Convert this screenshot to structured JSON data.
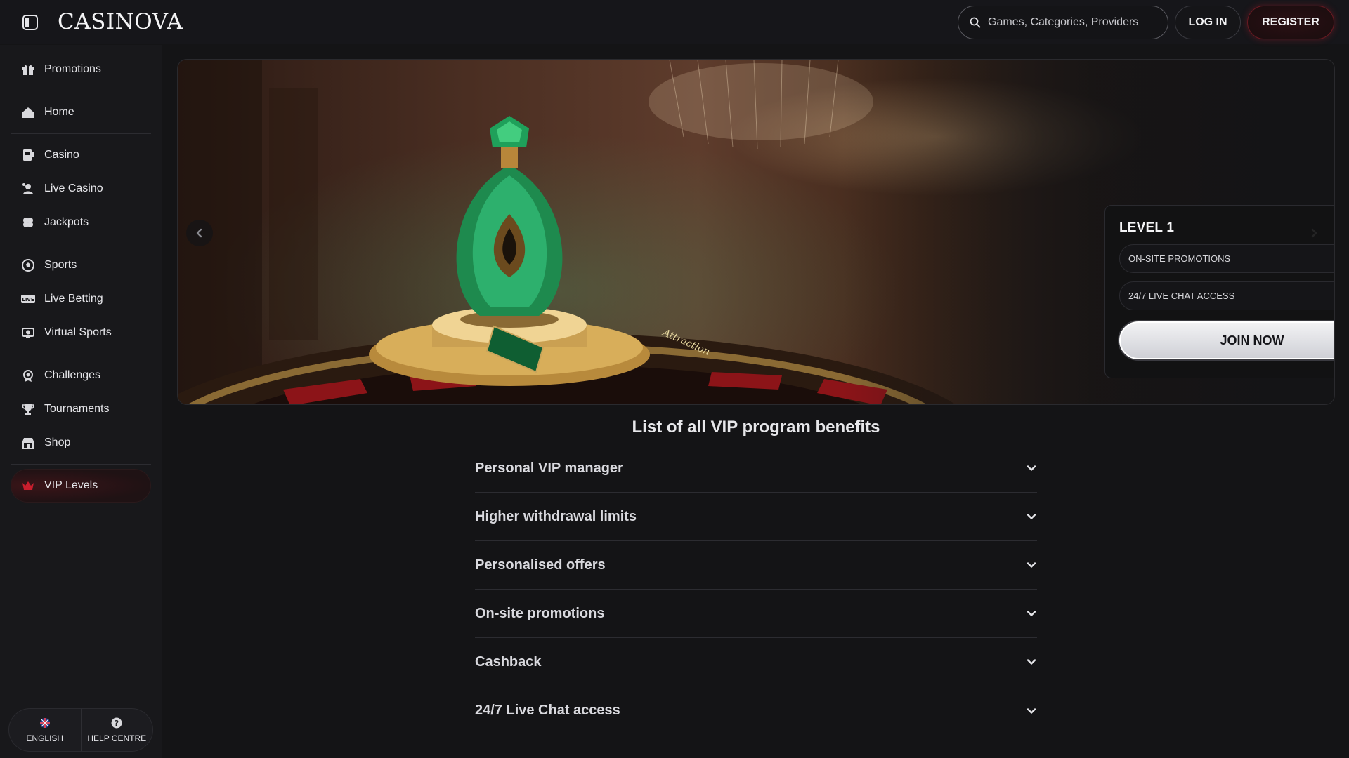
{
  "header": {
    "logo": "CASINOVA",
    "search_placeholder": "Games, Categories, Providers",
    "login_label": "LOG IN",
    "register_label": "REGISTER"
  },
  "sidebar": {
    "groups": [
      [
        {
          "label": "Promotions",
          "icon": "gift-icon"
        }
      ],
      [
        {
          "label": "Home",
          "icon": "home-icon"
        }
      ],
      [
        {
          "label": "Casino",
          "icon": "slot-machine-icon"
        },
        {
          "label": "Live Casino",
          "icon": "live-dealer-icon"
        },
        {
          "label": "Jackpots",
          "icon": "clover-icon"
        }
      ],
      [
        {
          "label": "Sports",
          "icon": "football-icon"
        },
        {
          "label": "Live Betting",
          "icon": "live-badge-icon"
        },
        {
          "label": "Virtual Sports",
          "icon": "virtual-sports-icon"
        }
      ],
      [
        {
          "label": "Challenges",
          "icon": "target-icon"
        },
        {
          "label": "Tournaments",
          "icon": "trophy-icon"
        },
        {
          "label": "Shop",
          "icon": "shop-icon"
        }
      ],
      [
        {
          "label": "VIP Levels",
          "icon": "crown-icon",
          "active": true
        }
      ]
    ],
    "footer": {
      "language_label": "ENGLISH",
      "help_label": "HELP CENTRE"
    }
  },
  "hero": {
    "level_title": "LEVEL 1",
    "perks": [
      "ON-SITE PROMOTIONS",
      "24/7 LIVE CHAT ACCESS"
    ],
    "cta_label": "JOIN NOW",
    "bottle_tag": "Attraction"
  },
  "benefits": {
    "title": "List of all VIP program benefits",
    "items": [
      "Personal VIP manager",
      "Higher withdrawal limits",
      "Personalised offers",
      "On-site promotions",
      "Cashback",
      "24/7 Live Chat access"
    ]
  },
  "colors": {
    "background": "#141416",
    "accent_red": "#c81e2d",
    "text_primary": "#e9e9ec"
  }
}
